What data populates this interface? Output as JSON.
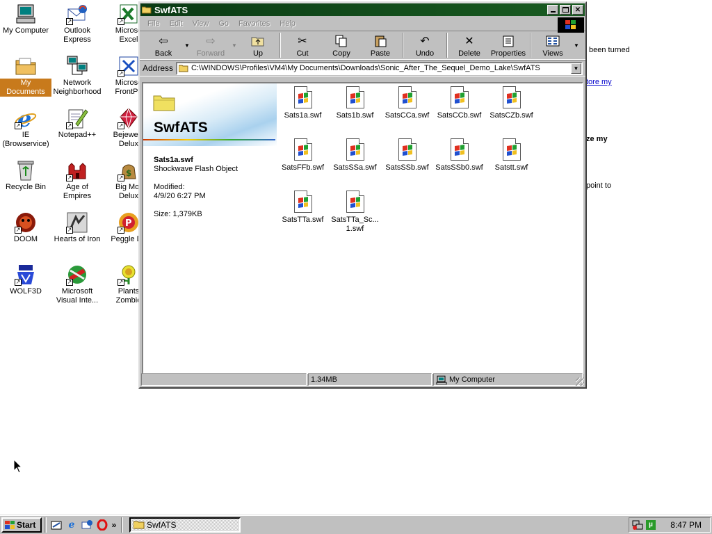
{
  "desktop": {
    "icons": [
      {
        "label": "My Computer",
        "icon": "my-computer-icon"
      },
      {
        "label": "Outlook Express",
        "icon": "outlook-express-icon"
      },
      {
        "label": "Microsoft Excel",
        "icon": "excel-icon"
      },
      {
        "label": "My Documents",
        "icon": "my-documents-icon",
        "selected": true
      },
      {
        "label": "Network Neighborhood",
        "icon": "network-icon"
      },
      {
        "label": "Microsoft FrontPage",
        "icon": "frontpage-icon"
      },
      {
        "label": "IE (Browservice)",
        "icon": "ie-icon"
      },
      {
        "label": "Notepad++",
        "icon": "notepad-icon"
      },
      {
        "label": "Bejeweled Deluxe",
        "icon": "bejeweled-icon"
      },
      {
        "label": "Recycle Bin",
        "icon": "recycle-bin-icon"
      },
      {
        "label": "Age of Empires",
        "icon": "age-of-empires-icon"
      },
      {
        "label": "Big Money Deluxe",
        "icon": "big-money-icon"
      },
      {
        "label": "DOOM",
        "icon": "doom-icon"
      },
      {
        "label": "Hearts of Iron",
        "icon": "hearts-of-iron-icon"
      },
      {
        "label": "Peggle Deluxe",
        "icon": "peggle-icon"
      },
      {
        "label": "WOLF3D",
        "icon": "wolf3d-icon"
      },
      {
        "label": "Microsoft Visual Inte...",
        "icon": "visual-interdev-icon"
      },
      {
        "label": "Plants vs Zombies",
        "icon": "plants-zombies-icon"
      }
    ],
    "visible_labels": {
      "my_computer": "My Computer",
      "outlook_1": "Outlook",
      "outlook_2": "Express",
      "excel_1": "Microso",
      "excel_2": "Excel",
      "my_documents": "My Documents",
      "network_1": "Network",
      "network_2": "Neighborhood",
      "frontpage_1": "Microso",
      "frontpage_2": "FrontPa",
      "ie_1": "IE",
      "ie_2": "(Browservice)",
      "notepad": "Notepad++",
      "bejeweled_1": "Bejewele",
      "bejeweled_2": "Delux",
      "recycle": "Recycle Bin",
      "aoe_1": "Age of",
      "aoe_2": "Empires",
      "bigmoney_1": "Big Mor",
      "bigmoney_2": "Delux",
      "doom": "DOOM",
      "hoi": "Hearts of Iron",
      "peggle": "Peggle De",
      "wolf": "WOLF3D",
      "vi_1": "Microsoft",
      "vi_2": "Visual Inte...",
      "pvz_1": "Plants",
      "pvz_2": "Zombie"
    }
  },
  "background_text": {
    "t1": "been turned",
    "t2": "tore my",
    "t3": "ze my",
    "t4": "point to"
  },
  "window": {
    "title": "SwfATS",
    "menus": [
      "File",
      "Edit",
      "View",
      "Go",
      "Favorites",
      "Help"
    ],
    "toolbar": {
      "back": "Back",
      "forward": "Forward",
      "up": "Up",
      "cut": "Cut",
      "copy": "Copy",
      "paste": "Paste",
      "undo": "Undo",
      "delete": "Delete",
      "properties": "Properties",
      "views": "Views"
    },
    "address_label": "Address",
    "address_value": "C:\\WINDOWS\\Profiles\\VM4\\My Documents\\Downloads\\Sonic_After_The_Sequel_Demo_Lake\\SwfATS",
    "webview": {
      "folder_title": "SwfATS",
      "selected_name": "Sats1a.swf",
      "selected_type": "Shockwave Flash Object",
      "modified_label": "Modified:",
      "modified_value": "4/9/20 6:27 PM",
      "size": "Size: 1,379KB"
    },
    "files": [
      "Sats1a.swf",
      "Sats1b.swf",
      "SatsCCa.swf",
      "SatsCCb.swf",
      "SatsCZb.swf",
      "SatsFFb.swf",
      "SatsSSa.swf",
      "SatsSSb.swf",
      "SatsSSb0.swf",
      "Satstt.swf",
      "SatsTTa.swf",
      "SatsTTa_Sc...",
      "1.swf"
    ],
    "status": {
      "size": "1.34MB",
      "zone": "My Computer"
    }
  },
  "taskbar": {
    "start": "Start",
    "task_title": "SwfATS",
    "clock": "8:47 PM",
    "quick_more": "»"
  },
  "colors": {
    "titlebar": "#0a3a14",
    "selection": "#c87a1c",
    "face": "#c0c0c0"
  }
}
